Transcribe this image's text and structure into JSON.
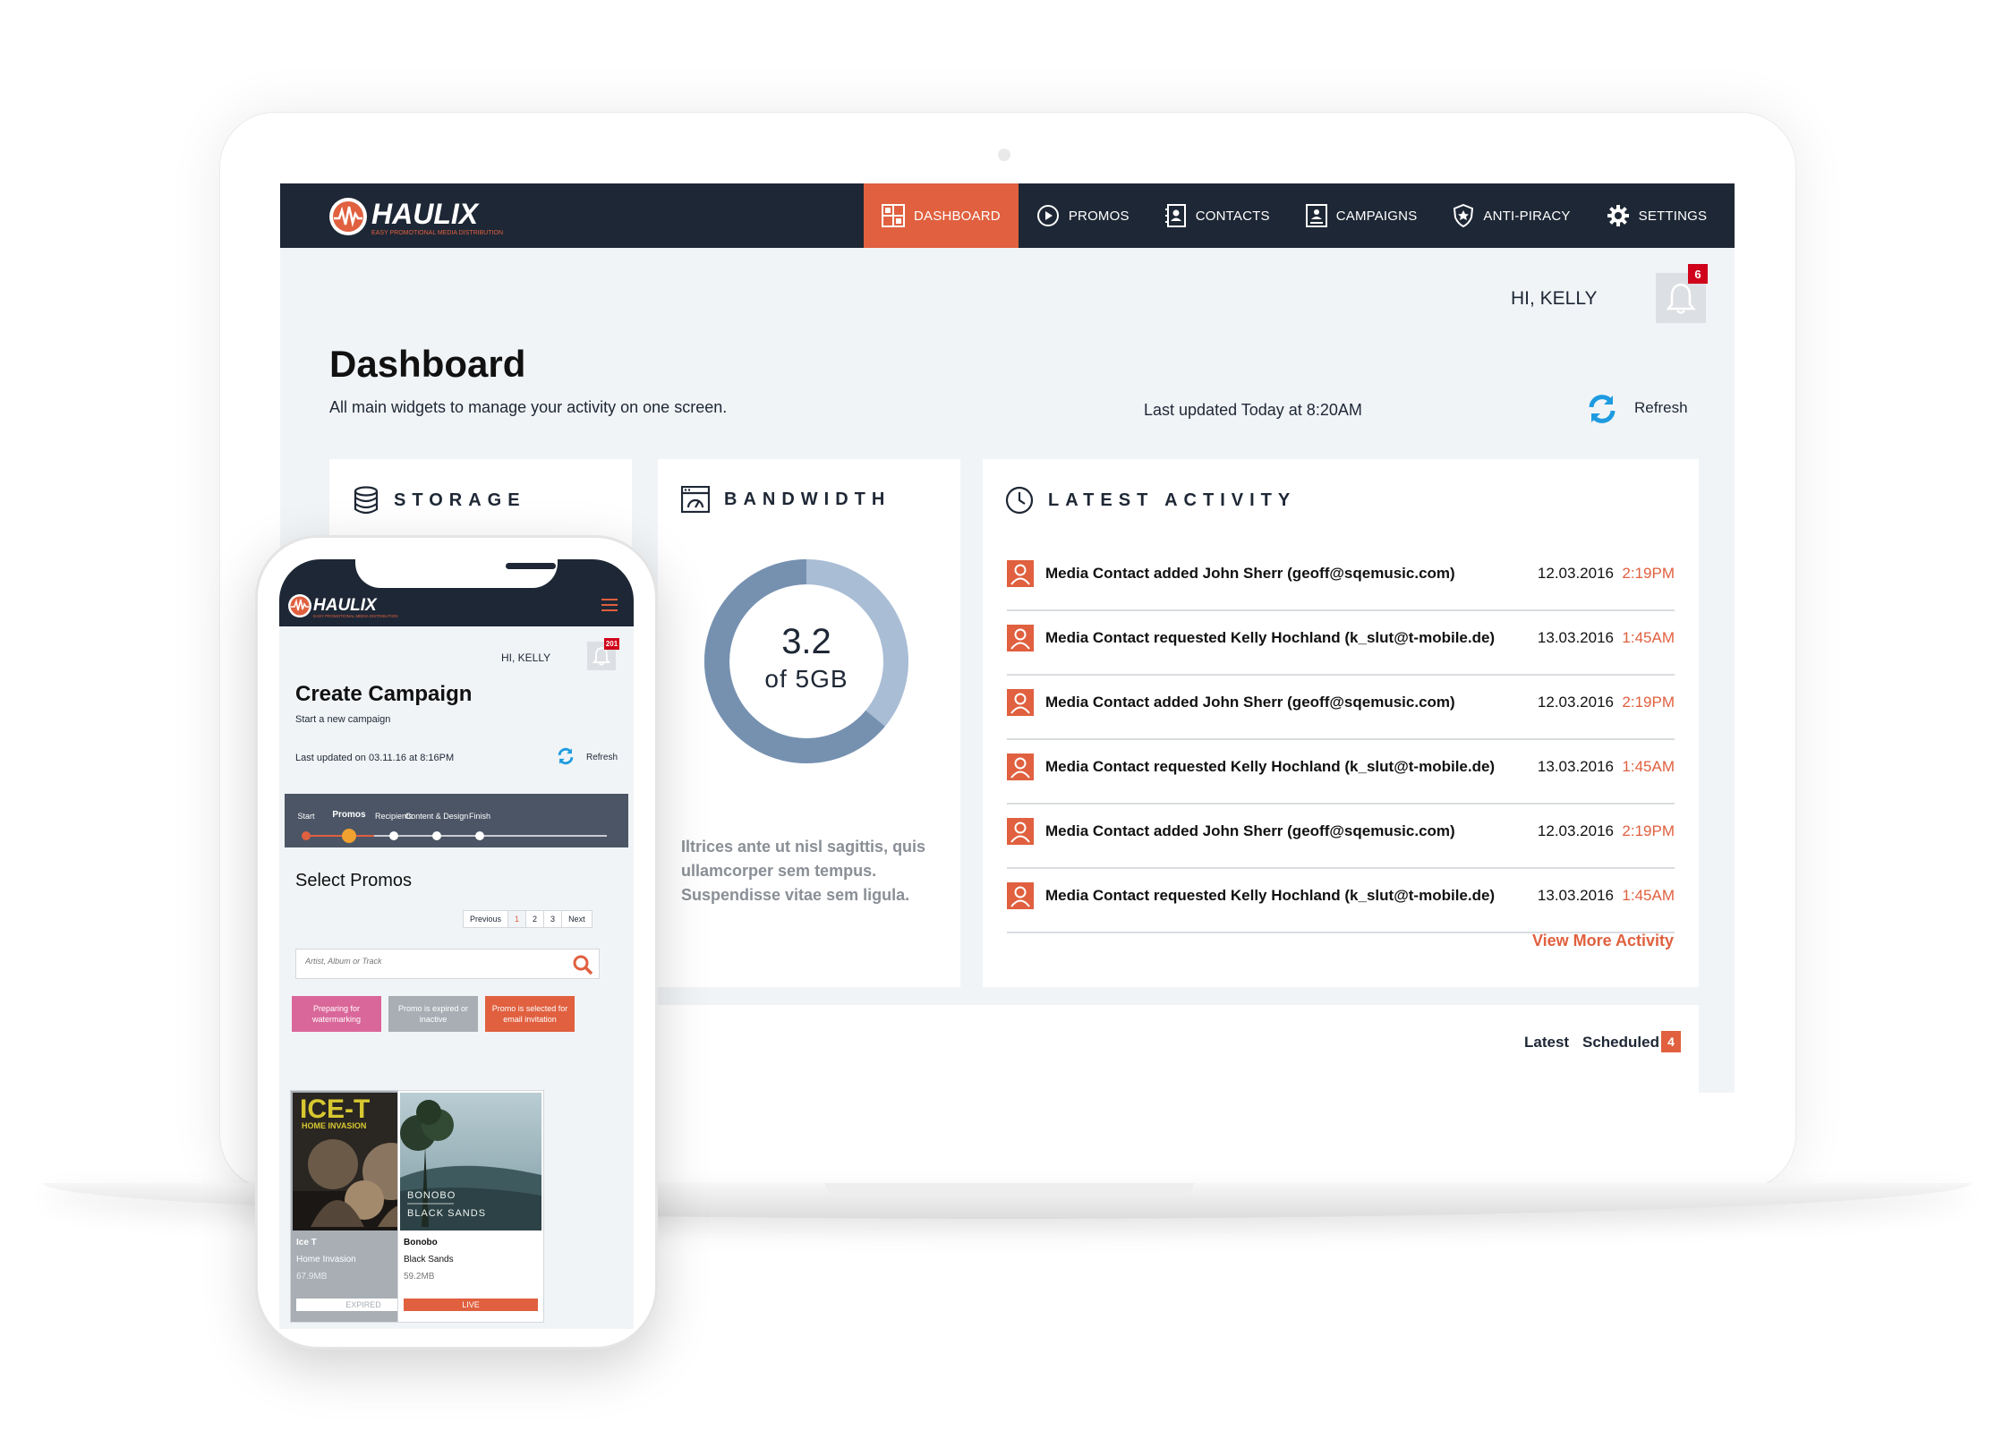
{
  "desktop": {
    "brand": {
      "name": "HAULIX",
      "tagline": "EASY PROMOTIONAL MEDIA DISTRIBUTION"
    },
    "nav": [
      {
        "label": "DASHBOARD",
        "icon": "grid-icon",
        "active": true
      },
      {
        "label": "PROMOS",
        "icon": "play-icon",
        "active": false
      },
      {
        "label": "CONTACTS",
        "icon": "contact-book-icon",
        "active": false
      },
      {
        "label": "CAMPAIGNS",
        "icon": "campaign-icon",
        "active": false
      },
      {
        "label": "ANTI-PIRACY",
        "icon": "shield-icon",
        "active": false
      },
      {
        "label": "SETTINGS",
        "icon": "gear-icon",
        "active": false
      }
    ],
    "greeting": "HI, KELLY",
    "notifications_count": "6",
    "page": {
      "title": "Dashboard",
      "subtitle": "All main widgets to manage your activity on one screen.",
      "last_updated": "Last updated Today at 8:20AM",
      "refresh_label": "Refresh"
    },
    "storage": {
      "title": "STORAGE"
    },
    "bandwidth": {
      "title": "BANDWIDTH",
      "used": "3.2",
      "total_label": "of 5GB",
      "used_value": 3.2,
      "total_value": 5,
      "description": "Iltrices ante ut nisl sagittis, quis ullamcorper sem tempus. Suspendisse vitae sem ligula."
    },
    "activity": {
      "title": "LATEST ACTIVITY",
      "items": [
        {
          "text": "Media Contact added John Sherr (geoff@sqemusic.com)",
          "date": "12.03.2016",
          "time": "2:19PM"
        },
        {
          "text": "Media Contact requested Kelly Hochland (k_slut@t-mobile.de)",
          "date": "13.03.2016",
          "time": "1:45AM"
        },
        {
          "text": "Media Contact added John Sherr (geoff@sqemusic.com)",
          "date": "12.03.2016",
          "time": "2:19PM"
        },
        {
          "text": "Media Contact requested Kelly Hochland (k_slut@t-mobile.de)",
          "date": "13.03.2016",
          "time": "1:45AM"
        },
        {
          "text": "Media Contact added John Sherr (geoff@sqemusic.com)",
          "date": "12.03.2016",
          "time": "2:19PM"
        },
        {
          "text": "Media Contact requested Kelly Hochland (k_slut@t-mobile.de)",
          "date": "13.03.2016",
          "time": "1:45AM"
        }
      ],
      "view_more": "View More Activity"
    },
    "tabs": {
      "latest": "Latest",
      "scheduled": "Scheduled",
      "scheduled_count": "4"
    }
  },
  "mobile": {
    "brand": {
      "name": "HAULIX",
      "tagline": "EASY PROMOTIONAL MEDIA DISTRIBUTION"
    },
    "greeting": "HI, KELLY",
    "notifications_count": "201",
    "page": {
      "title": "Create Campaign",
      "subtitle": "Start a new campaign",
      "last_updated": "Last updated on 03.11.16 at 8:16PM",
      "refresh_label": "Refresh"
    },
    "steps": [
      {
        "label": "Start",
        "state": "done"
      },
      {
        "label": "Promos",
        "state": "current"
      },
      {
        "label": "Recipients",
        "state": "todo"
      },
      {
        "label": "Content & Design",
        "state": "todo"
      },
      {
        "label": "Finish",
        "state": "todo"
      }
    ],
    "section_title": "Select Promos",
    "pager": {
      "previous": "Previous",
      "pages": [
        "1",
        "2",
        "3"
      ],
      "next": "Next"
    },
    "search": {
      "placeholder": "Artist, Album or Track",
      "value": ""
    },
    "legend": [
      {
        "label": "Preparing for watermarking",
        "color": "#d9679a"
      },
      {
        "label": "Promo is expired or inactive",
        "color": "#a8aeb4"
      },
      {
        "label": "Promo is selected for email invitation",
        "color": "#e0603f"
      }
    ],
    "albums": [
      {
        "artist": "Ice T",
        "title": "Home Invasion",
        "size": "67.9MB",
        "status": "EXPIRED",
        "cover_text": "ICE-T",
        "cover_sub": "HOME INVASION"
      },
      {
        "artist": "Bonobo",
        "title": "Black Sands",
        "size": "59.2MB",
        "status": "LIVE",
        "cover_text": "BONOBO",
        "cover_sub": "BLACK SANDS"
      }
    ]
  },
  "colors": {
    "accent": "#e0603f",
    "nav_bg": "#1e2735",
    "page_bg": "#f1f4f7",
    "donut_used": "#7691b0",
    "donut_free": "#a9bdd5"
  }
}
